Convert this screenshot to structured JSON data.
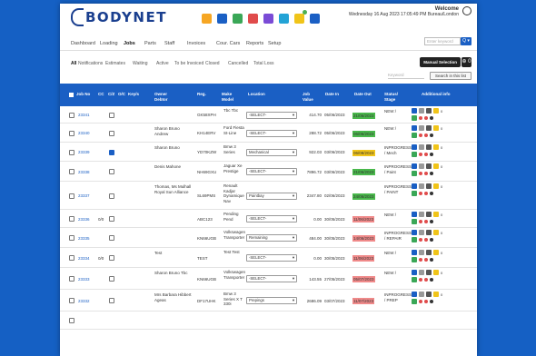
{
  "header": {
    "logo": {
      "body": "BODY",
      "net": "NET"
    },
    "welcome": {
      "title": "Welcome",
      "sub": "Wednesday 16 Aug 2023 17:05:49 PM  Bureau/London"
    },
    "app_icons": [
      {
        "name": "jobs-app-icon",
        "color": "#f6a623"
      },
      {
        "name": "estimating-app-icon",
        "color": "#1a5fc4"
      },
      {
        "name": "parts-app-icon",
        "color": "#3aa757"
      },
      {
        "name": "invoice-app-icon",
        "color": "#e04b4b"
      },
      {
        "name": "courtesy-app-icon",
        "color": "#7a4bd6"
      },
      {
        "name": "chart-app-icon",
        "color": "#23a3d6"
      },
      {
        "name": "alerts-app-icon",
        "color": "#f0c419"
      },
      {
        "name": "settings-app-icon",
        "color": "#1a5fc4"
      }
    ]
  },
  "nav": {
    "items": [
      "Dashboard",
      "Loading",
      "Jobs",
      "Parts",
      "Staff",
      "Invoices",
      "Cour. Cars",
      "Reports",
      "Setup"
    ],
    "active": "Jobs",
    "keyword_placeholder": "Enter keyword",
    "search_button": "Q ▾"
  },
  "subnav": {
    "items": [
      "All",
      "Notifications",
      "Estimates",
      "Waiting",
      "Active",
      "To be Invoiced",
      "Closed",
      "Cancelled",
      "Total Loss"
    ],
    "active": "All",
    "manual_button": "Manual Selection",
    "plus_button": "⊕ 0",
    "keyword_label": "Keyword",
    "search_list_button": "Search in this list"
  },
  "table": {
    "headers": {
      "job": "Job No",
      "cc": "CC",
      "czo": "C/Z",
      "oc": "O/C",
      "keys": "Key/s",
      "owner": "Owner Debtor",
      "reg": "Reg.",
      "make": "Make Model",
      "location": "Location",
      "value": "Job Value",
      "datein": "Date In",
      "dateout": "Date Out",
      "status": "Status/ Stage",
      "additional": "Additional info"
    },
    "rows": [
      {
        "job": "23341",
        "czo": "",
        "cb2": false,
        "owner": "",
        "reg": "GK58XPH",
        "make": "Tbc Tbc",
        "location": "-SELECT-",
        "value": "414.70",
        "datein": "05/06/2023",
        "dateout": "21/06/2023",
        "dateout_color": "#49b84b",
        "status": "NEW /"
      },
      {
        "job": "23340",
        "czo": "",
        "cb2": false,
        "owner": "Sharon Bruno Andrew",
        "reg": "KH14ERV",
        "make": "Ford Fiesta St-Line",
        "location": "-SELECT-",
        "value": "288.72",
        "datein": "05/06/2023",
        "dateout": "06/06/2023",
        "dateout_color": "#49b84b",
        "status": "NEW /"
      },
      {
        "job": "23339",
        "czo": "",
        "cb2": true,
        "owner": "Sharon Bruno",
        "reg": "YD70KZW",
        "make": "Bmw 3 Series",
        "location": "Mechanical",
        "value": "922.03",
        "datein": "03/06/2023",
        "dateout": "06/08/2023",
        "dateout_color": "#f0c419",
        "status": "INPROGRESS / Mech"
      },
      {
        "job": "23338",
        "czo": "",
        "cb2": false,
        "owner": "Denis Mahone",
        "reg": "NH69GXU",
        "make": "Jaguar Xe Prestige",
        "location": "-SELECT-",
        "value": "7896.72",
        "datein": "03/06/2023",
        "dateout": "21/06/2023",
        "dateout_color": "#49b84b",
        "status": "INPROGRESS / Paint"
      },
      {
        "job": "23337",
        "czo": "",
        "cb2": false,
        "owner": "Thomas, Ms Mulhall Royal Sun Alliance",
        "reg": "SL69PMS",
        "make": "Renault Kadjar Dynamique Nav",
        "location": "Paintbay",
        "value": "2347.80",
        "datein": "02/06/2023",
        "dateout": "24/06/2023",
        "dateout_color": "#49b84b",
        "status": "INPROGRESS / PAINT"
      },
      {
        "job": "23336",
        "czo": "0/0",
        "cb2": false,
        "owner": "",
        "reg": "ABC123",
        "make": "Pending Pend",
        "location": "-SELECT-",
        "value": "0.00",
        "datein": "30/05/2023",
        "dateout": "11/06/2023",
        "dateout_color": "#f08a8a",
        "status": "NEW /"
      },
      {
        "job": "23335",
        "czo": "",
        "cb2": false,
        "owner": "",
        "reg": "KN66UGB",
        "make": "Volkswagen Transporter",
        "location": "Remaining",
        "value": "484.00",
        "datein": "30/05/2023",
        "dateout": "14/06/2023",
        "dateout_color": "#f08a8a",
        "status": "INPROGRESS / REPAIR"
      },
      {
        "job": "23334",
        "czo": "0/0",
        "cb2": false,
        "owner": "Test",
        "reg": "TEST",
        "make": "Test Test",
        "location": "-SELECT-",
        "value": "0.00",
        "datein": "30/05/2023",
        "dateout": "11/06/2023",
        "dateout_color": "#f08a8a",
        "status": "NEW /"
      },
      {
        "job": "23333",
        "czo": "",
        "cb2": false,
        "owner": "Sharon Bruno Tbc",
        "reg": "KN66UGB",
        "make": "Volkswagen Transporter",
        "location": "-SELECT-",
        "value": "143.55",
        "datein": "27/05/2023",
        "dateout": "05/07/2023",
        "dateout_color": "#f08a8a",
        "status": "NEW /"
      },
      {
        "job": "23332",
        "czo": "",
        "cb2": false,
        "owner": "Mrs Barbara Hibbert Ageas",
        "reg": "DF17UHK",
        "make": "Bmw 3 Series X T 330i",
        "location": "Prepings",
        "value": "2686.09",
        "datein": "03/07/2023",
        "dateout": "11/07/2023",
        "dateout_color": "#f08a8a",
        "status": "INPROGRESS / PREP"
      },
      {
        "job": "",
        "czo": "",
        "cb2": false,
        "owner": "",
        "reg": "",
        "make": "",
        "location": "",
        "value": "",
        "datein": "",
        "dateout": "",
        "dateout_color": "#ffffff",
        "status": ""
      }
    ],
    "row_heights": [
      19,
      21,
      21,
      22,
      31,
      20,
      22,
      22,
      24,
      24,
      20
    ],
    "location_caret": "▾",
    "action_counts": [
      "0",
      "0",
      "0",
      "0",
      "0",
      "0",
      "0",
      "0",
      "0",
      "0",
      "0"
    ]
  }
}
